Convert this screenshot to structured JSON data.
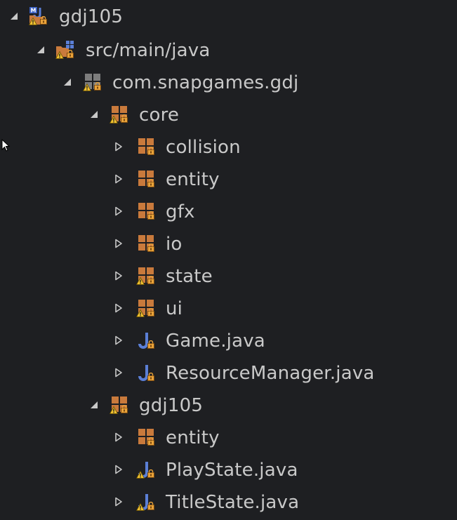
{
  "tree": {
    "project": {
      "label": "gdj105",
      "icon": "maven-project-warning-icon"
    },
    "source_folder": {
      "label": "src/main/java",
      "icon": "source-folder-warning-icon"
    },
    "root_package": {
      "label": "com.snapgames.gdj",
      "icon": "package-warning-icon"
    },
    "core_package": {
      "label": "core",
      "icon": "package-warning-icon",
      "children": [
        {
          "label": "collision",
          "icon": "package-icon"
        },
        {
          "label": "entity",
          "icon": "package-icon"
        },
        {
          "label": "gfx",
          "icon": "package-icon"
        },
        {
          "label": "io",
          "icon": "package-icon"
        },
        {
          "label": "state",
          "icon": "package-warning-icon"
        },
        {
          "label": "ui",
          "icon": "package-warning-icon"
        },
        {
          "label": "Game.java",
          "icon": "java-file-icon"
        },
        {
          "label": "ResourceManager.java",
          "icon": "java-file-icon"
        }
      ]
    },
    "gdj105_package": {
      "label": "gdj105",
      "icon": "package-warning-icon",
      "children": [
        {
          "label": "entity",
          "icon": "package-icon"
        },
        {
          "label": "PlayState.java",
          "icon": "java-file-warning-icon"
        },
        {
          "label": "TitleState.java",
          "icon": "java-file-warning-icon"
        }
      ]
    }
  },
  "colors": {
    "background": "#1e1f22",
    "text": "#c9c9c9",
    "package_orange": "#c97a3c",
    "java_blue": "#5b7fd6",
    "warning_yellow": "#f2c230",
    "lock_orange": "#e8a23a"
  }
}
